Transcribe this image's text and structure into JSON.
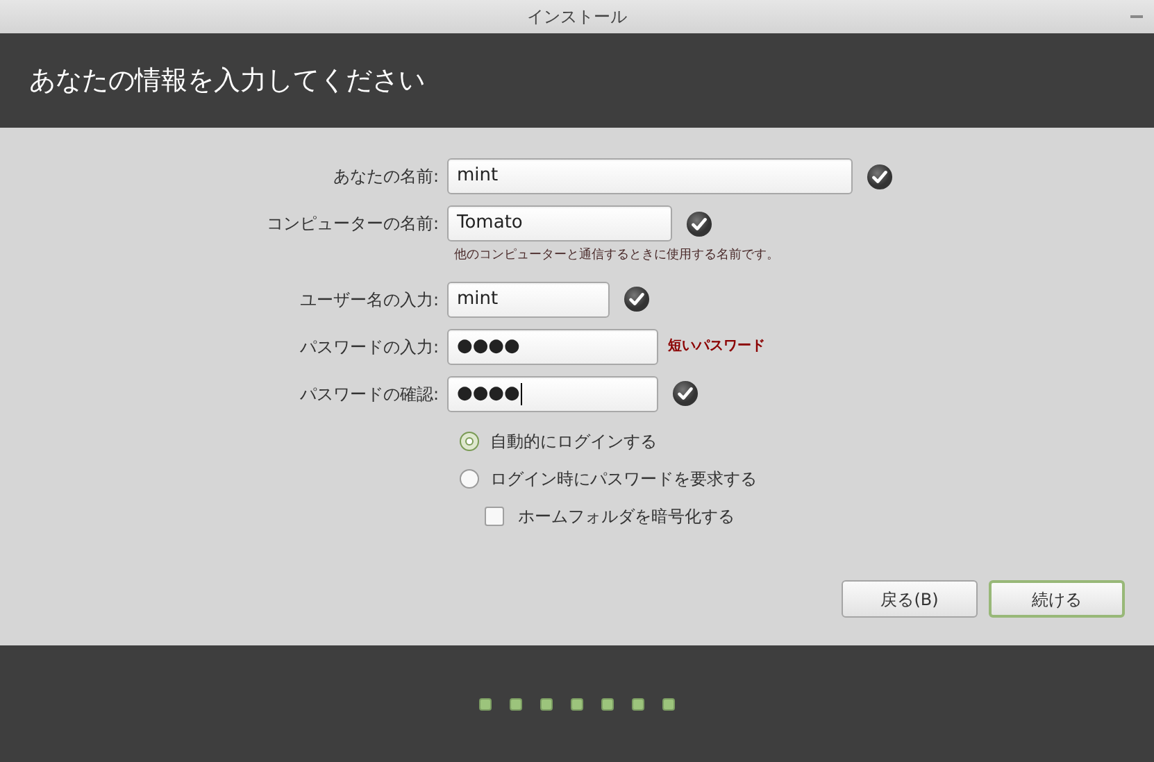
{
  "window": {
    "title": "インストール"
  },
  "header": {
    "title": "あなたの情報を入力してください"
  },
  "fields": [
    {
      "label": "あなたの名前:",
      "value": "mint",
      "valid": true,
      "focused": false
    },
    {
      "label": "コンピューターの名前:",
      "value": "Tomato",
      "valid": true,
      "focused": false,
      "hint": "他のコンピューターと通信するときに使用する名前です。"
    },
    {
      "label": "ユーザー名の入力:",
      "value": "mint",
      "valid": true,
      "focused": false
    },
    {
      "label": "パスワードの入力:",
      "value": "●●●●",
      "valid": false,
      "message": "短いパスワード",
      "focused": false
    },
    {
      "label": "パスワードの確認:",
      "value": "●●●●",
      "valid": true,
      "focused": true
    }
  ],
  "login_options": [
    {
      "kind": "radio",
      "label": "自動的にログインする",
      "selected": true
    },
    {
      "kind": "radio",
      "label": "ログイン時にパスワードを要求する",
      "selected": false
    },
    {
      "kind": "checkbox",
      "label": "ホームフォルダを暗号化する",
      "checked": false
    }
  ],
  "buttons": [
    {
      "label": "戻る(B)",
      "default": false
    },
    {
      "label": "続ける",
      "default": true
    }
  ],
  "progress_steps": [
    {
      "done": true
    },
    {
      "done": true
    },
    {
      "done": true
    },
    {
      "done": true
    },
    {
      "done": true
    },
    {
      "done": true
    },
    {
      "done": true
    }
  ]
}
